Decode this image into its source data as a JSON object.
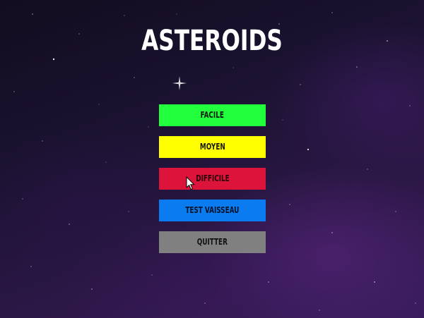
{
  "title": "ASTEROIDS",
  "menu": {
    "easy": "FACILE",
    "medium": "MOYEN",
    "hard": "DIFFICILE",
    "test_ship": "TEST VAISSEAU",
    "quit": "QUITTER"
  },
  "colors": {
    "easy": "#22ff3d",
    "medium": "#ffff00",
    "hard": "#dc143c",
    "test_ship": "#0a7cf0",
    "quit": "#808080"
  },
  "icons": {
    "pointer": "mouse-pointer-icon",
    "sparkle": "star-sparkle-icon"
  }
}
